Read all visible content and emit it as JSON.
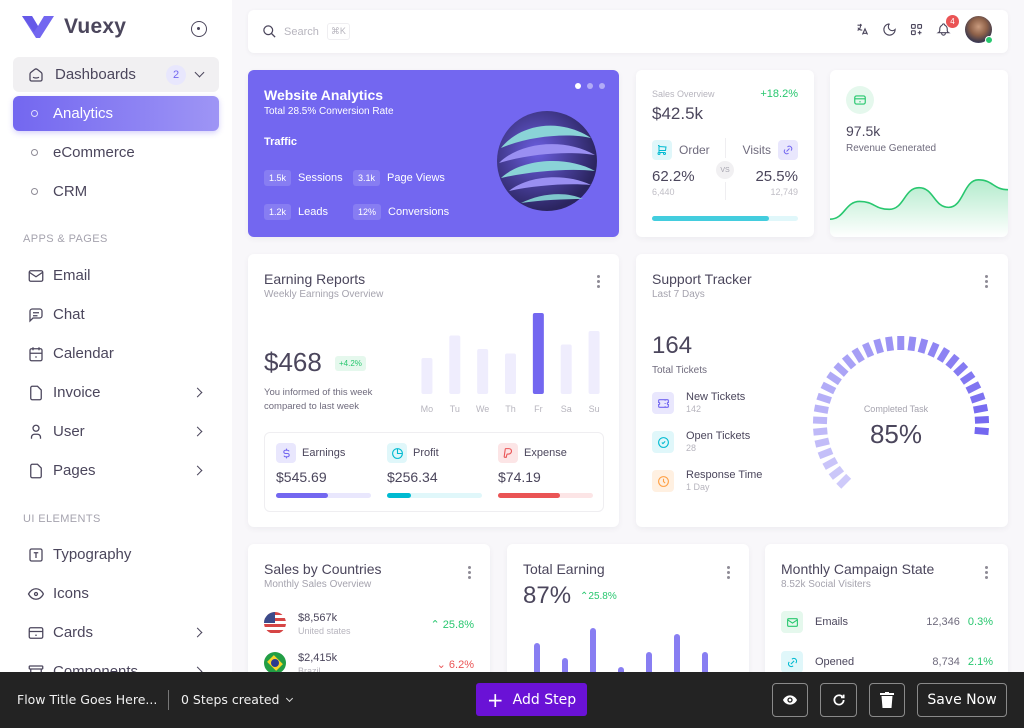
{
  "brand": {
    "name": "Vuexy"
  },
  "sidebar": {
    "dashboards": {
      "label": "Dashboards",
      "count": "2"
    },
    "dashboard_items": [
      {
        "label": "Analytics",
        "active": true
      },
      {
        "label": "eCommerce",
        "active": false
      },
      {
        "label": "CRM",
        "active": false
      }
    ],
    "section_apps": "APPS & PAGES",
    "apps": [
      {
        "label": "Email",
        "icon": "mail-icon",
        "has_children": false
      },
      {
        "label": "Chat",
        "icon": "chat-icon",
        "has_children": false
      },
      {
        "label": "Calendar",
        "icon": "calendar-icon",
        "has_children": false
      },
      {
        "label": "Invoice",
        "icon": "file-icon",
        "has_children": true
      },
      {
        "label": "User",
        "icon": "user-icon",
        "has_children": true
      },
      {
        "label": "Pages",
        "icon": "file-icon",
        "has_children": true
      }
    ],
    "section_ui": "UI ELEMENTS",
    "ui": [
      {
        "label": "Typography",
        "icon": "typography-icon",
        "has_children": false
      },
      {
        "label": "Icons",
        "icon": "eye-icon",
        "has_children": false
      },
      {
        "label": "Cards",
        "icon": "card-icon",
        "has_children": true
      },
      {
        "label": "Components",
        "icon": "archive-icon",
        "has_children": true
      }
    ]
  },
  "topbar": {
    "search_placeholder": "Search",
    "shortcut": "⌘K",
    "notification_count": "4",
    "icons": [
      "translate-icon",
      "moon-icon",
      "apps-add-icon",
      "bell-icon"
    ]
  },
  "website_analytics": {
    "title": "Website Analytics",
    "subtitle": "Total 28.5% Conversion Rate",
    "section": "Traffic",
    "stats": [
      {
        "value": "1.5k",
        "label": "Sessions"
      },
      {
        "value": "3.1k",
        "label": "Page Views"
      },
      {
        "value": "1.2k",
        "label": "Leads"
      },
      {
        "value": "12%",
        "label": "Conversions"
      }
    ],
    "slides": 3,
    "active_slide": 0
  },
  "sales_overview": {
    "label": "Sales Overview",
    "change": "+18.2%",
    "value": "$42.5k",
    "order": {
      "label": "Order",
      "percent": "62.2%",
      "count": "6,440"
    },
    "visits": {
      "label": "Visits",
      "percent": "25.5%",
      "count": "12,749"
    },
    "vs": "VS",
    "progress": 0.8
  },
  "revenue": {
    "value": "97.5k",
    "label": "Revenue Generated",
    "series": [
      10,
      28,
      20,
      42,
      22,
      50,
      40
    ]
  },
  "earning_reports": {
    "title": "Earning Reports",
    "subtitle": "Weekly Earnings Overview",
    "amount": "$468",
    "change": "+4.2%",
    "note": "You informed of this week compared to last week",
    "days": [
      "Mo",
      "Tu",
      "We",
      "Th",
      "Fr",
      "Sa",
      "Su"
    ],
    "values": [
      40,
      65,
      50,
      45,
      90,
      55,
      70
    ],
    "highlight_index": 4,
    "stats": [
      {
        "label": "Earnings",
        "amount": "$545.69",
        "progress": 0.55,
        "color": "#7367f0",
        "track": "#e9e7fd",
        "icon": "dollar-icon",
        "icon_bg": "#e9e7fd"
      },
      {
        "label": "Profit",
        "amount": "$256.34",
        "progress": 0.25,
        "color": "#00bad1",
        "track": "#e0f7fa",
        "icon": "pie-chart-icon",
        "icon_bg": "#e0f7fa"
      },
      {
        "label": "Expense",
        "amount": "$74.19",
        "progress": 0.65,
        "color": "#ea5455",
        "track": "#fce5e6",
        "icon": "brand-paypal-icon",
        "icon_bg": "#fce5e6"
      }
    ]
  },
  "support_tracker": {
    "title": "Support Tracker",
    "subtitle": "Last 7 Days",
    "total": "164",
    "total_label": "Total Tickets",
    "items": [
      {
        "title": "New Tickets",
        "value": "142",
        "icon": "ticket-icon",
        "color": "#7367f0",
        "bg": "#e9e7fd"
      },
      {
        "title": "Open Tickets",
        "value": "28",
        "icon": "check-circle-icon",
        "color": "#00bad1",
        "bg": "#e0f7fa"
      },
      {
        "title": "Response Time",
        "value": "1 Day",
        "icon": "clock-icon",
        "color": "#ff9f43",
        "bg": "#fff0e1"
      }
    ],
    "gauge_label": "Completed Task",
    "gauge_value": "85%",
    "gauge_fraction": 0.85
  },
  "sales_by_countries": {
    "title": "Sales by Countries",
    "subtitle": "Monthly Sales Overview",
    "rows": [
      {
        "amount": "$8,567k",
        "country": "United states",
        "change": "25.8%",
        "direction": "up"
      },
      {
        "amount": "$2,415k",
        "country": "Brazil",
        "change": "6.2%",
        "direction": "down"
      }
    ]
  },
  "total_earning": {
    "title": "Total Earning",
    "value": "87%",
    "change": "25.8%",
    "bars": [
      55,
      30,
      80,
      15,
      40,
      70,
      40
    ]
  },
  "campaign": {
    "title": "Monthly Campaign State",
    "subtitle": "8.52k Social Visiters",
    "rows": [
      {
        "label": "Emails",
        "value": "12,346",
        "pct": "0.3%",
        "icon": "mail-icon",
        "color": "#28c76f",
        "bg": "#e5f8ed"
      },
      {
        "label": "Opened",
        "value": "8,734",
        "pct": "2.1%",
        "icon": "link-icon",
        "color": "#00bad1",
        "bg": "#e0f7fa"
      }
    ]
  },
  "flowbar": {
    "title": "Flow Title Goes Here...",
    "steps": "0 Steps created",
    "add_step": "Add Step",
    "save": "Save Now"
  },
  "colors": {
    "primary": "#7367f0",
    "success": "#28c76f",
    "info": "#00bad1",
    "danger": "#ea5455",
    "warning": "#ff9f43",
    "flow_primary": "#6a12d6"
  }
}
